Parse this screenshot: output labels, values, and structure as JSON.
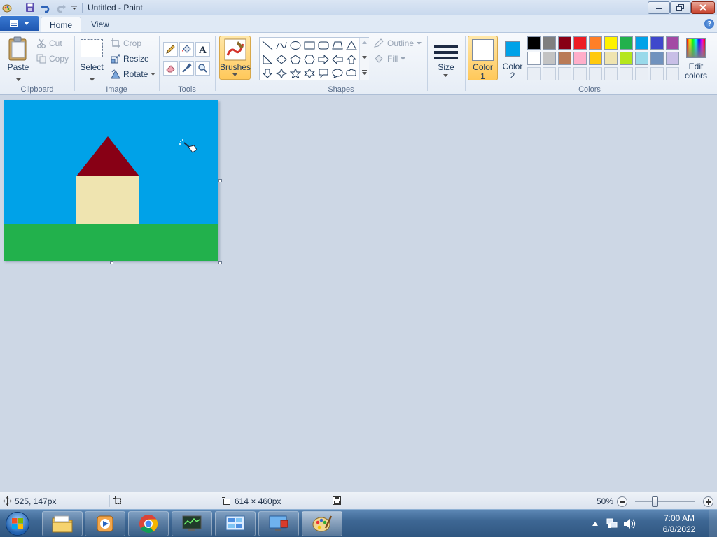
{
  "window": {
    "title": "Untitled - Paint"
  },
  "tabs": {
    "home": "Home",
    "view": "View"
  },
  "ribbon": {
    "clipboard": {
      "label": "Clipboard",
      "paste": "Paste",
      "cut": "Cut",
      "copy": "Copy"
    },
    "image": {
      "label": "Image",
      "select": "Select",
      "crop": "Crop",
      "resize": "Resize",
      "rotate": "Rotate"
    },
    "tools": {
      "label": "Tools"
    },
    "brushes": {
      "label": "Brushes"
    },
    "shapes": {
      "label": "Shapes",
      "outline": "Outline",
      "fill": "Fill"
    },
    "size": {
      "label": "Size"
    },
    "colors": {
      "label": "Colors",
      "color1_line1": "Color",
      "color1_line2": "1",
      "color2_line1": "Color",
      "color2_line2": "2",
      "edit_line1": "Edit",
      "edit_line2": "colors",
      "color1_value": "#ffffff",
      "color2_value": "#00a2e8",
      "palette_row1": [
        "#000000",
        "#7f7f7f",
        "#880015",
        "#ed1c24",
        "#ff7f27",
        "#fff200",
        "#22b14c",
        "#00a2e8",
        "#3f48cc",
        "#a349a4"
      ],
      "palette_row2": [
        "#ffffff",
        "#c3c3c3",
        "#b97a57",
        "#ffaec9",
        "#ffc90e",
        "#efe4b0",
        "#b5e61d",
        "#99d9ea",
        "#7092be",
        "#c8bfe7"
      ]
    }
  },
  "canvas": {
    "sky_color": "#00a2e8",
    "grass_color": "#22b14c",
    "roof_color": "#880015",
    "wall_color": "#efe4b0"
  },
  "status": {
    "cursor_pos": "525, 147px",
    "canvas_size": "614 × 460px",
    "zoom": "50%",
    "zoom_fraction": 0.5
  },
  "taskbar": {
    "time": "7:00 AM",
    "date": "6/8/2022"
  }
}
